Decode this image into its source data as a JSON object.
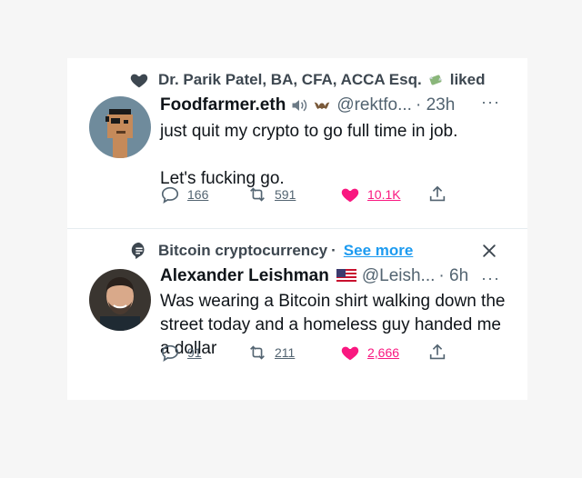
{
  "tweets": [
    {
      "context": {
        "text": "Dr. Parik Patel, BA, CFA, ACCA Esq.",
        "suffix": "liked",
        "icon": "heart-icon"
      },
      "name": "Foodfarmer.eth",
      "handle": "@rektfo...",
      "time": "· 23h",
      "more": "···",
      "text_lines": [
        "just quit my crypto to go full time in job.",
        "Let's fucking go."
      ],
      "actions": {
        "replies": "166",
        "retweets": "591",
        "likes": "10.1K"
      }
    },
    {
      "context": {
        "text": "Bitcoin cryptocurrency",
        "separator": "·",
        "link": "See more",
        "icon": "topic-icon"
      },
      "name": "Alexander Leishman",
      "handle": "@Leish...",
      "time": "· 6h",
      "more": "···",
      "text": "Was wearing a Bitcoin shirt walking down the street today and a homeless guy handed me a dollar",
      "actions": {
        "replies": "91",
        "retweets": "211",
        "likes": "2,666"
      }
    }
  ],
  "colors": {
    "accent": "#1d9bf0",
    "like": "#f91880",
    "muted": "#536471",
    "text": "#0f1419"
  }
}
